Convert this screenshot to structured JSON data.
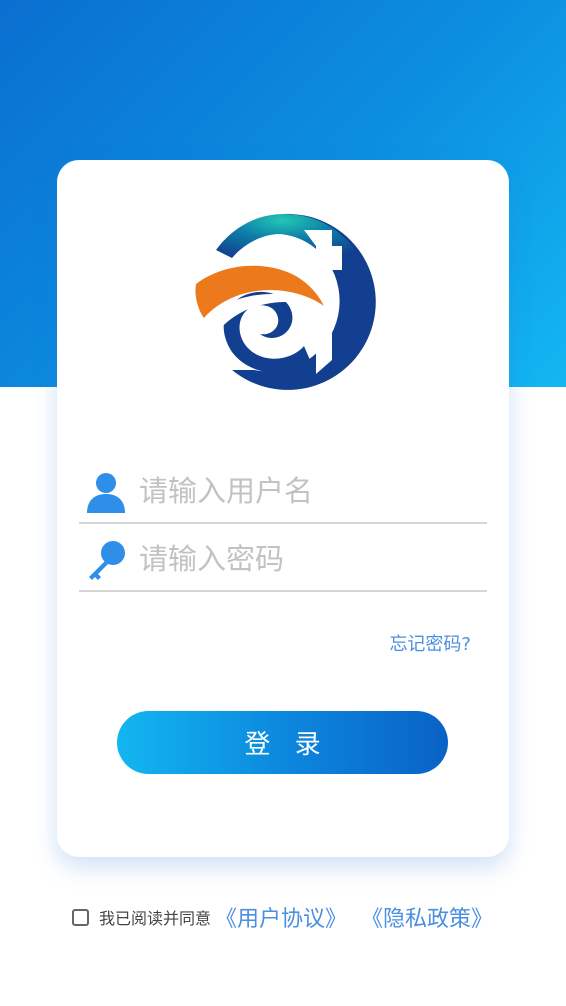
{
  "colors": {
    "primary": "#0c84dc",
    "header_gradient_start": "#0a6fd0",
    "header_gradient_end": "#13b7f2",
    "link": "#4a8fe0",
    "placeholder": "#c2c2c2",
    "logo_orange": "#ec7a1d",
    "logo_navy": "#123f8f",
    "logo_teal": "#1fb5a8"
  },
  "logo": {
    "icon": "company-logo-icon"
  },
  "login_form": {
    "username": {
      "icon": "user-icon",
      "placeholder": "请输入用户名"
    },
    "password": {
      "icon": "key-icon",
      "placeholder": "请输入密码"
    },
    "forgot_password_label": "忘记密码?",
    "login_button_label": "登 录"
  },
  "agreement": {
    "checked": false,
    "prefix_text": "我已阅读并同意",
    "user_agreement_link": "《用户协议》",
    "privacy_policy_link": "《隐私政策》"
  }
}
